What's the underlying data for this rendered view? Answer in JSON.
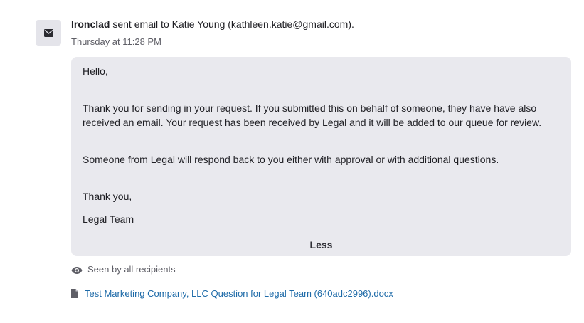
{
  "event": {
    "sender": "Ironclad",
    "action_text": " sent email to Katie Young (kathleen.katie@gmail.com).",
    "timestamp": "Thursday at 11:28 PM",
    "icon": "mail-icon"
  },
  "email": {
    "greeting": "Hello,",
    "body_1": "Thank you for sending in your request. If you submitted this on behalf of someone, they have have also received an email. Your request has been received by Legal and it will be added to our queue for review.",
    "body_2": "Someone from Legal will respond back to you either with approval or with additional questions.",
    "closing": "Thank you,",
    "signature": "Legal Team",
    "toggle_label": "Less"
  },
  "status": {
    "seen_text": "Seen by all recipients",
    "icon": "eye-icon"
  },
  "attachment": {
    "filename": "Test Marketing Company, LLC Question for Legal Team (640adc2996).docx",
    "icon": "document-icon",
    "link_color": "#1d6aa8"
  }
}
